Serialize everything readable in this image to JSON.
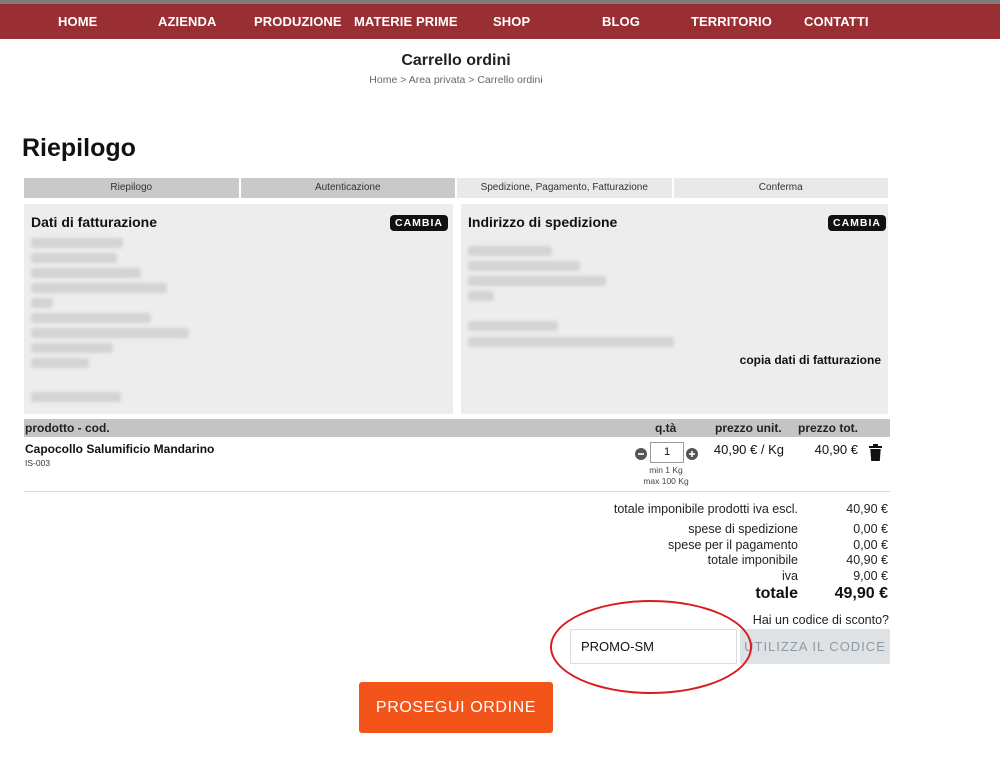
{
  "nav": {
    "items": [
      "HOME",
      "AZIENDA",
      "PRODUZIONE",
      "MATERIE PRIME",
      "SHOP",
      "BLOG",
      "TERRITORIO",
      "CONTATTI"
    ]
  },
  "page": {
    "title": "Carrello ordini",
    "breadcrumb": [
      "Home",
      ">",
      "Area privata",
      ">",
      "Carrello ordini"
    ]
  },
  "section_title": "Riepilogo",
  "steps": [
    "Riepilogo",
    "Autenticazione",
    "Spedizione, Pagamento, Fatturazione",
    "Conferma"
  ],
  "billing": {
    "title": "Dati di fatturazione",
    "change_label": "CAMBIA"
  },
  "shipping": {
    "title": "Indirizzo di spedizione",
    "change_label": "CAMBIA",
    "copy_label": "copia dati di fatturazione"
  },
  "table": {
    "headers": {
      "product": "prodotto - cod.",
      "qty": "q.tà",
      "unit_price": "prezzo unit.",
      "total_price": "prezzo tot."
    },
    "rows": [
      {
        "name": "Capocollo Salumificio Mandarino",
        "code": "IS-003",
        "qty": "1",
        "qty_min": "min 1 Kg",
        "qty_max": "max 100 Kg",
        "unit_price": "40,90 € / Kg",
        "total_price": "40,90 €"
      }
    ]
  },
  "summary": [
    {
      "label": "totale imponibile prodotti iva escl.",
      "value": "40,90 €"
    },
    {
      "label": "spese di spedizione",
      "value": "0,00 €"
    },
    {
      "label": "spese per il pagamento",
      "value": "0,00 €"
    },
    {
      "label": "totale imponibile",
      "value": "40,90 €"
    },
    {
      "label": "iva",
      "value": "9,00 €"
    },
    {
      "label": "totale",
      "value": "49,90 €"
    }
  ],
  "discount": {
    "question": "Hai un codice di sconto?",
    "code_value": "PROMO-SM",
    "apply_label": "UTILIZZA IL CODICE"
  },
  "proceed_label": "PROSEGUI ORDINE",
  "colors": {
    "nav_bg": "#9a2f33",
    "accent": "#f2541a",
    "annotation": "#d81c1c"
  }
}
